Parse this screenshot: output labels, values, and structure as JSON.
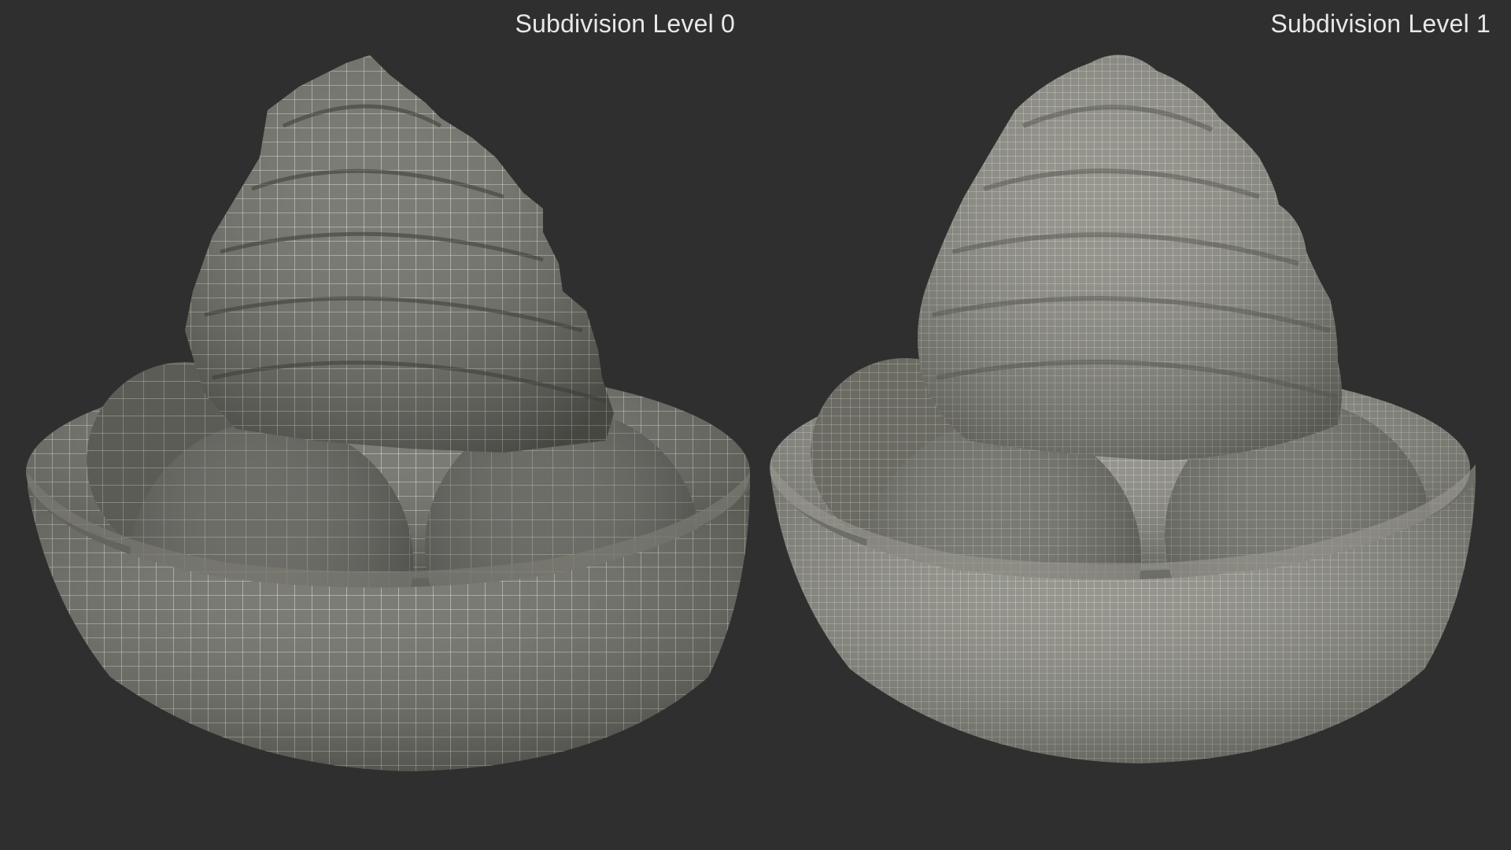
{
  "captions": {
    "left": "Subdivision Level 0",
    "right": "Subdivision Level 1"
  },
  "colors": {
    "background": "#2f2f2f",
    "mesh_fill_level0": "#6f6f68",
    "mesh_fill_level1": "#8a8a82",
    "wire_color": "#f3f0dc",
    "caption_text": "#e8e8e8"
  },
  "icons": {
    "left_model": "sundae-wireframe-low",
    "right_model": "sundae-wireframe-high"
  }
}
